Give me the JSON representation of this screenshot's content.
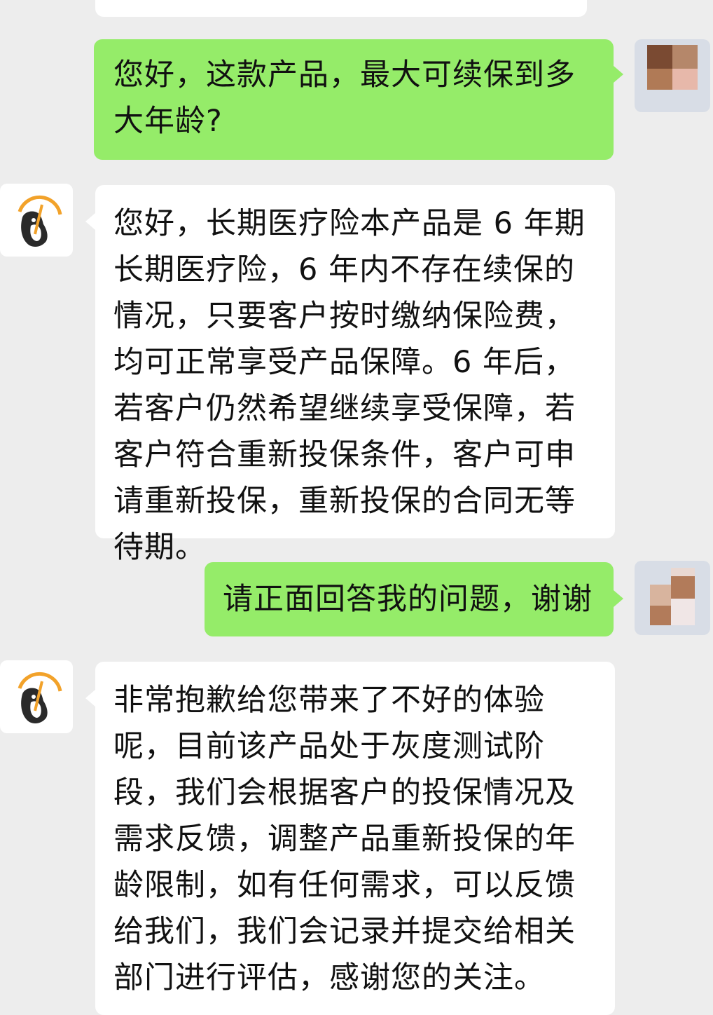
{
  "messages": [
    {
      "sender": "user",
      "text": "您好，这款产品，最大可续保到多大年龄?"
    },
    {
      "sender": "agent",
      "text": "您好，长期医疗险本产品是 6 年期长期医疗险，6 年内不存在续保的情况，只要客户按时缴纳保险费，均可正常享受产品保障。6 年后，若客户仍然希望继续享受保障，若客户符合重新投保条件，客户可申请重新投保，重新投保的合同无等待期。"
    },
    {
      "sender": "user",
      "text": "请正面回答我的问题，谢谢"
    },
    {
      "sender": "agent",
      "text": "非常抱歉给您带来了不好的体验呢，目前该产品处于灰度测试阶段，我们会根据客户的投保情况及需求反馈，调整产品重新投保的年龄限制，如有任何需求，可以反馈给我们，我们会记录并提交给相关部门进行评估，感谢您的关注。"
    }
  ],
  "colors": {
    "background": "#ededed",
    "user_bubble": "#95ec69",
    "agent_bubble": "#ffffff",
    "user_avatar_bg": "#d8dde6",
    "avatar_pixel_1": "#8a5a40",
    "avatar_pixel_2": "#c08f6e",
    "avatar_pixel_3": "#e0b7a6",
    "brand_orange": "#f2a22a",
    "brand_dark": "#2a2a2a"
  },
  "icons": {
    "user_avatar": "mosaic-user-avatar-icon",
    "agent_avatar": "penguin-mascot-icon"
  }
}
